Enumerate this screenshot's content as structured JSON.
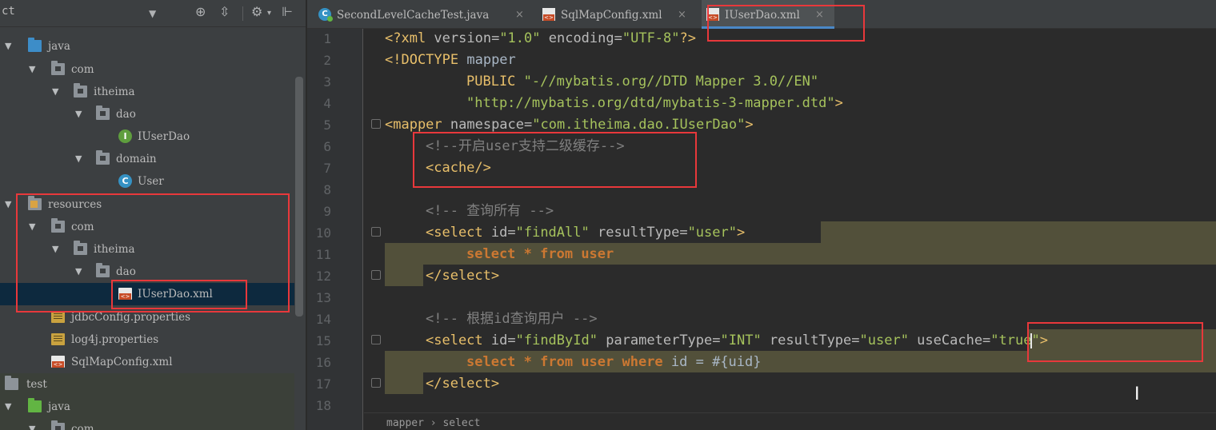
{
  "project": {
    "title": "ct",
    "tree": [
      {
        "label": "java",
        "arrow": "▼",
        "icon": "folder-blue"
      },
      {
        "label": "com",
        "arrow": "▼",
        "icon": "package"
      },
      {
        "label": "itheima",
        "arrow": "▼",
        "icon": "package"
      },
      {
        "label": "dao",
        "arrow": "▼",
        "icon": "package"
      },
      {
        "label": "IUserDao",
        "icon": "interface-I"
      },
      {
        "label": "domain",
        "arrow": "▼",
        "icon": "package"
      },
      {
        "label": "User",
        "icon": "class-C"
      },
      {
        "label": "resources",
        "arrow": "▼",
        "icon": "folder-resources"
      },
      {
        "label": "com",
        "arrow": "▼",
        "icon": "package"
      },
      {
        "label": "itheima",
        "arrow": "▼",
        "icon": "package"
      },
      {
        "label": "dao",
        "arrow": "▼",
        "icon": "package"
      },
      {
        "label": "IUserDao.xml",
        "icon": "xml-file",
        "selected": true
      },
      {
        "label": "jdbcConfig.properties",
        "icon": "properties-file"
      },
      {
        "label": "log4j.properties",
        "icon": "properties-file"
      },
      {
        "label": "SqlMapConfig.xml",
        "icon": "xml-file"
      },
      {
        "label": "test",
        "icon": "folder-gray"
      },
      {
        "label": "java",
        "arrow": "▼",
        "icon": "folder-green"
      },
      {
        "label": "com",
        "arrow": "▼",
        "icon": "package"
      }
    ]
  },
  "tabs": [
    {
      "label": "SecondLevelCacheTest.java",
      "close": "×",
      "icon": "java-class-icon"
    },
    {
      "label": "SqlMapConfig.xml",
      "close": "×",
      "icon": "xml-icon"
    },
    {
      "label": "IUserDao.xml",
      "close": "×",
      "icon": "xml-icon",
      "active": true
    }
  ],
  "editor": {
    "line_numbers": [
      "1",
      "2",
      "3",
      "4",
      "5",
      "6",
      "7",
      "8",
      "9",
      "10",
      "11",
      "12",
      "13",
      "14",
      "15",
      "16",
      "17",
      "18"
    ],
    "code": {
      "l1_t1": "<?xml ",
      "l1_a1": "version=",
      "l1_v1": "\"1.0\" ",
      "l1_a2": "encoding=",
      "l1_v2": "\"UTF-8\"",
      "l1_t2": "?>",
      "l2_t1": "<!DOCTYPE ",
      "l2_d": "mapper",
      "l3_d": "PUBLIC ",
      "l3_v": "\"-//mybatis.org//DTD Mapper 3.0//EN\"",
      "l4_v": "\"http://mybatis.org/dtd/mybatis-3-mapper.dtd\"",
      "l4_t": ">",
      "l5_t1": "<mapper ",
      "l5_a": "namespace=",
      "l5_v": "\"com.itheima.dao.IUserDao\"",
      "l5_t2": ">",
      "l6_c": "<!--开启user支持二级缓存-->",
      "l7_t": "<cache/>",
      "l9_c": "<!-- 查询所有 -->",
      "l10_t1": "<select ",
      "l10_a1": "id=",
      "l10_v1": "\"findAll\" ",
      "l10_a2": "resultType=",
      "l10_v2": "\"user\"",
      "l10_t2": ">",
      "l11_k1": "select ",
      "l11_p": "* ",
      "l11_k2": "from user",
      "l12_t": "</select>",
      "l14_c": "<!-- 根据id查询用户 -->",
      "l15_t1": "<select ",
      "l15_a1": "id=",
      "l15_v1": "\"findById\" ",
      "l15_a2": "parameterType=",
      "l15_v2": "\"INT\" ",
      "l15_a3": "resultType=",
      "l15_v3": "\"user\" ",
      "l15_a4": "useCache=",
      "l15_v4a": "\"true",
      "l15_v4b": "\"",
      "l15_t2": ">",
      "l16_k1": "select ",
      "l16_p1": "* ",
      "l16_k2": "from user where ",
      "l16_p2": "id = #{uid}",
      "l17_t": "</select>"
    },
    "breadcrumb": "mapper  ›  select"
  }
}
